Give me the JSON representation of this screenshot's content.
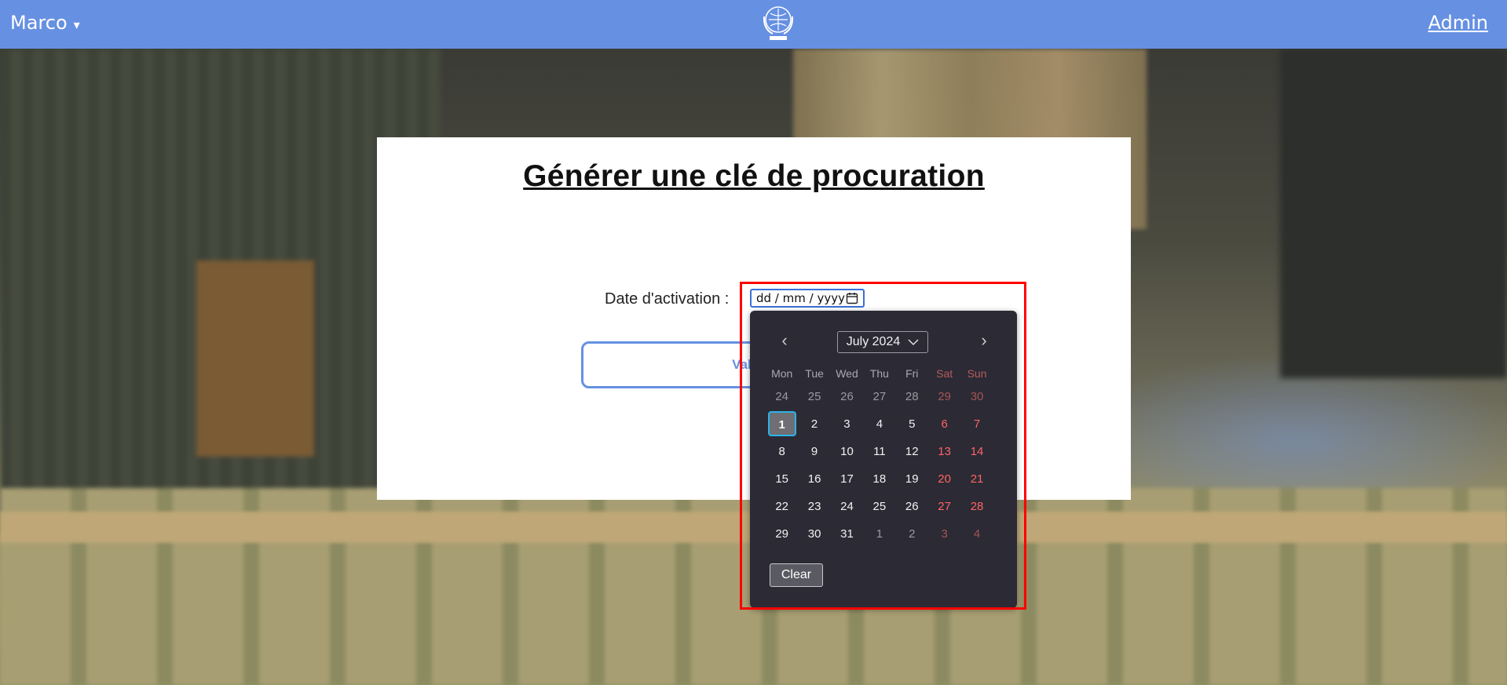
{
  "header": {
    "user_name": "Marco",
    "caret": "▾",
    "admin_label": "Admin",
    "bar_color": "#6690e2"
  },
  "logo": {
    "icon": "un-emblem-icon"
  },
  "card": {
    "title": "Générer une clé de procuration",
    "date_label": "Date d'activation :",
    "date_placeholder": "dd / mm / yyyy",
    "validate_label": "Valider"
  },
  "datepicker": {
    "month_label": "July 2024",
    "prev_icon": "‹",
    "next_icon": "›",
    "weekdays": [
      "Mon",
      "Tue",
      "Wed",
      "Thu",
      "Fri",
      "Sat",
      "Sun"
    ],
    "weeks": [
      [
        "24",
        "25",
        "26",
        "27",
        "28",
        "29",
        "30"
      ],
      [
        "1",
        "2",
        "3",
        "4",
        "5",
        "6",
        "7"
      ],
      [
        "8",
        "9",
        "10",
        "11",
        "12",
        "13",
        "14"
      ],
      [
        "15",
        "16",
        "17",
        "18",
        "19",
        "20",
        "21"
      ],
      [
        "22",
        "23",
        "24",
        "25",
        "26",
        "27",
        "28"
      ],
      [
        "29",
        "30",
        "31",
        "1",
        "2",
        "3",
        "4"
      ]
    ],
    "clear_label": "Clear",
    "weekend_color": "#ff6464",
    "focus_color": "#2bb4e8"
  },
  "highlight_color": "#ff0000"
}
